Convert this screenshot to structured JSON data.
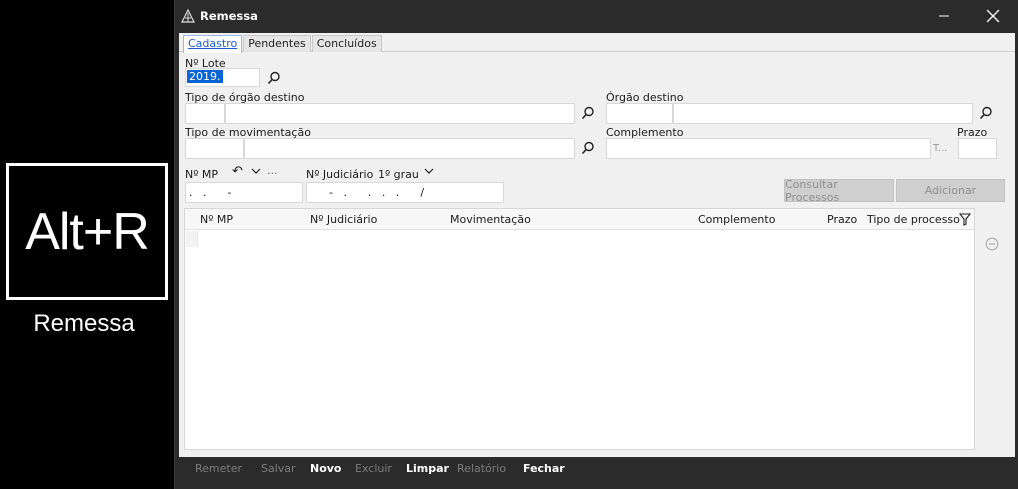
{
  "overlay": {
    "shortcut": "Alt+R",
    "caption": "Remessa"
  },
  "window": {
    "title": "Remessa",
    "icon": "app-logo-icon",
    "minimize_icon": "minimize-icon",
    "close_icon": "close-icon"
  },
  "tabs": [
    {
      "label": "Cadastro",
      "active": true
    },
    {
      "label": "Pendentes",
      "active": false
    },
    {
      "label": "Concluídos",
      "active": false
    }
  ],
  "form": {
    "lote": {
      "label": "Nº Lote",
      "value": "2019."
    },
    "tipo_orgao": {
      "label": "Tipo de órgão destino"
    },
    "orgao": {
      "label": "Órgão destino"
    },
    "tipo_mov": {
      "label": "Tipo de movimentação"
    },
    "complemento": {
      "label": "Complemento",
      "placeholder": "T..."
    },
    "prazo": {
      "label": "Prazo"
    },
    "mp": {
      "label": "Nº MP",
      "mask": ".   .      -",
      "undo_glyph": "↶",
      "dropdown_glyph": "﹀",
      "more_glyph": "···"
    },
    "judiciario": {
      "label": "Nº Judiciário",
      "grau": "1º grau",
      "mask": "-   .      .   .   .      /"
    }
  },
  "buttons": {
    "consultar": "Consultar Processos",
    "adicionar": "Adicionar"
  },
  "grid": {
    "columns": [
      "Nº MP",
      "Nº Judiciário",
      "Movimentação",
      "Complemento",
      "Prazo",
      "Tipo de processo"
    ],
    "filter_icon": "filter-icon",
    "remove_icon": "remove-circle-icon"
  },
  "footer": [
    {
      "label": "Remeter",
      "enabled": false
    },
    {
      "label": "Salvar",
      "enabled": false
    },
    {
      "label": "Novo",
      "enabled": true
    },
    {
      "label": "Excluir",
      "enabled": false
    },
    {
      "label": "Limpar",
      "enabled": true
    },
    {
      "label": "Relatório",
      "enabled": false
    },
    {
      "label": "Fechar",
      "enabled": true
    }
  ]
}
